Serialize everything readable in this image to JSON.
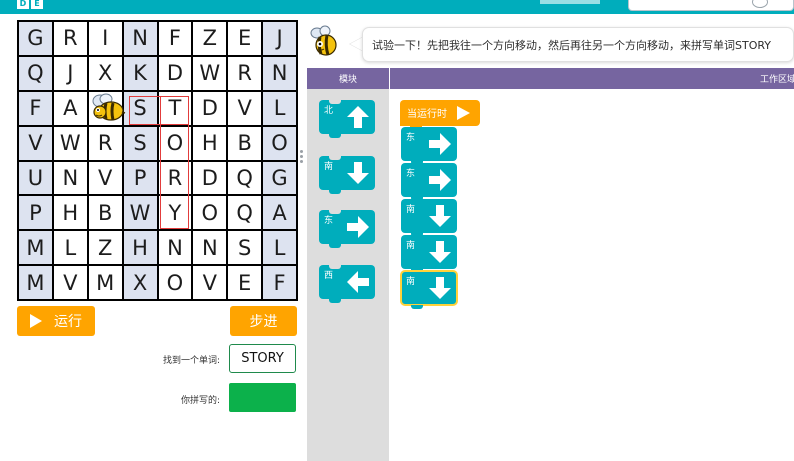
{
  "app": {
    "logo_letters": [
      "D",
      "E"
    ]
  },
  "instructions": {
    "text": "试验一下！先把我往一个方向移动，然后再往另一个方向移动，来拼写单词STORY"
  },
  "grid": {
    "rows": [
      [
        "G",
        "R",
        "I",
        "N",
        "F",
        "Z",
        "E",
        "J"
      ],
      [
        "Q",
        "J",
        "X",
        "K",
        "D",
        "W",
        "R",
        "N"
      ],
      [
        "F",
        "A",
        "",
        "S",
        "T",
        "D",
        "V",
        "L"
      ],
      [
        "V",
        "W",
        "R",
        "S",
        "O",
        "H",
        "B",
        "O"
      ],
      [
        "U",
        "N",
        "V",
        "P",
        "R",
        "D",
        "Q",
        "G"
      ],
      [
        "P",
        "H",
        "B",
        "W",
        "Y",
        "O",
        "Q",
        "A"
      ],
      [
        "M",
        "L",
        "Z",
        "H",
        "N",
        "N",
        "S",
        "L"
      ],
      [
        "M",
        "V",
        "M",
        "X",
        "O",
        "V",
        "E",
        "F"
      ]
    ]
  },
  "controls": {
    "run_label": "运行",
    "step_label": "步进",
    "found_word_label": "找到一个单词:",
    "found_word_value": "STORY",
    "spelled_label": "你拼写的:",
    "spelled_value": ""
  },
  "toolbox": {
    "header": "模块",
    "blocks": [
      {
        "label": "北",
        "icon": "arrow-up-icon"
      },
      {
        "label": "南",
        "icon": "arrow-down-icon"
      },
      {
        "label": "东",
        "icon": "arrow-right-icon"
      },
      {
        "label": "西",
        "icon": "arrow-left-icon"
      }
    ]
  },
  "workspace": {
    "header": "工作区域",
    "when_run_label": "当运行时",
    "blocks": [
      {
        "label": "东",
        "icon": "arrow-right-icon"
      },
      {
        "label": "东",
        "icon": "arrow-right-icon"
      },
      {
        "label": "南",
        "icon": "arrow-down-icon"
      },
      {
        "label": "南",
        "icon": "arrow-down-icon"
      },
      {
        "label": "南",
        "icon": "arrow-down-icon"
      }
    ]
  },
  "colors": {
    "accent": "#00adbc",
    "run_button": "#ffa400",
    "header": "#7665a0",
    "spelled_box": "#0cb14b",
    "highlight": "#e23c3c"
  }
}
